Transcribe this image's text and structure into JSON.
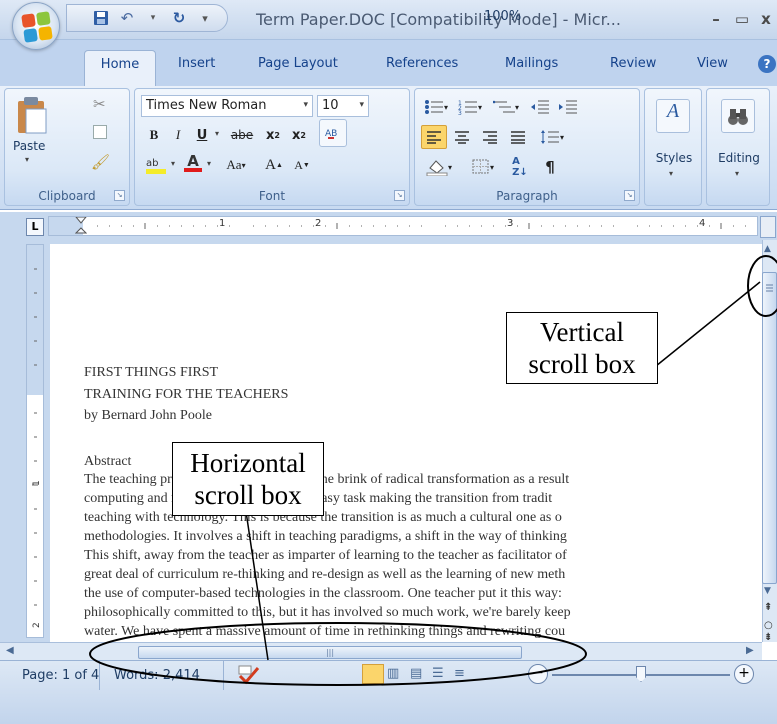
{
  "window": {
    "title": "Term Paper.DOC [Compatibility Mode] - Micr...",
    "minimize": "–",
    "maximize": "▭",
    "close": "x"
  },
  "quick_access": {
    "save_icon": "save-icon",
    "undo_icon": "undo-icon",
    "redo_icon": "redo-icon",
    "customize": "▾"
  },
  "tabs": [
    "Home",
    "Insert",
    "Page Layout",
    "References",
    "Mailings",
    "Review",
    "View"
  ],
  "ribbon": {
    "clipboard": {
      "label": "Clipboard",
      "paste": "Paste"
    },
    "font": {
      "label": "Font",
      "family": "Times New Roman",
      "size": "10",
      "bold": "B",
      "italic": "I",
      "underline": "U",
      "strike": "abe",
      "subscript": "x",
      "superscript": "x",
      "aa": "Aa",
      "grow": "A",
      "shrink": "A",
      "color_a": "A"
    },
    "paragraph": {
      "label": "Paragraph",
      "pilcrow": "¶"
    },
    "styles": {
      "label": "Styles"
    },
    "editing": {
      "label": "Editing"
    }
  },
  "ruler": {
    "numbers": [
      "1",
      "2",
      "3",
      "4"
    ]
  },
  "document": {
    "lines": [
      "FIRST THINGS FIRST",
      "TRAINING FOR THE TEACHERS",
      "by Bernard John Poole",
      "Abstract",
      "The teaching profession appears to be on the brink of radical transformation as a result",
      "computing and networking tools.  It is no easy task making the transition from tradit",
      "teaching with technology.  This is because the transition is  as much a cultural one as o",
      "methodologies.  It involves a shift in teaching paradigms, a shift in the way of thinking",
      "This shift, away from the teacher as imparter of learning to the teacher as facilitator of",
      "great deal of curriculum re-thinking and re-design  as well  as the learning of new meth",
      "the use of computer-based technologies in the classroom.  One teacher put it this way: ",
      "philosophically committed to this, but it has involved so much work, we're  barely keep",
      "water.  We have spent a massive amount of time in rethinking things and rewriting  cou"
    ]
  },
  "status": {
    "page": "Page: 1 of 4",
    "words": "Words: 2,414",
    "zoom": "100%"
  },
  "annotations": {
    "vertical": [
      "Vertical",
      "scroll box"
    ],
    "horizontal": [
      "Horizontal",
      "scroll box"
    ]
  }
}
